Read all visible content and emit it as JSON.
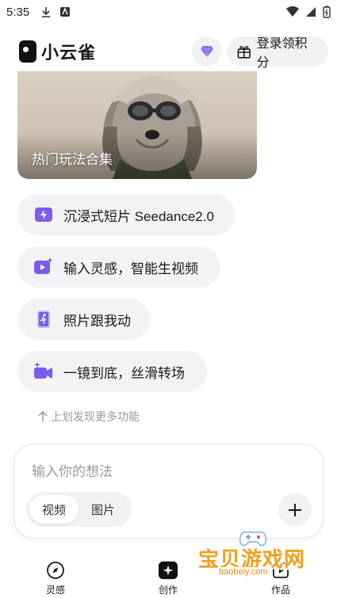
{
  "status": {
    "time": "5:35"
  },
  "header": {
    "app_name": "小云雀",
    "login_label": "登录领积分"
  },
  "hero": {
    "label": "热门玩法合集"
  },
  "features": [
    {
      "label": "沉浸式短片 Seedance2.0",
      "icon": "lightning-icon"
    },
    {
      "label": "输入灵感，智能生视频",
      "icon": "video-sparkle-icon"
    },
    {
      "label": "照片跟我动",
      "icon": "running-photo-icon"
    },
    {
      "label": "一镜到底，丝滑转场",
      "icon": "camera-sparkle-icon"
    }
  ],
  "hint": "上划发现更多功能",
  "composer": {
    "placeholder": "输入你的想法",
    "tabs": [
      "视频",
      "图片"
    ],
    "active_tab": "视频"
  },
  "nav": [
    {
      "label": "灵感",
      "icon": "compass-icon"
    },
    {
      "label": "创作",
      "icon": "create-icon"
    },
    {
      "label": "作品",
      "icon": "works-icon"
    }
  ],
  "watermark": {
    "title": "宝贝游戏网",
    "url": "baobeiy.com"
  },
  "colors": {
    "accent": "#7b5cf0",
    "pill_bg": "#f3f3f5"
  }
}
